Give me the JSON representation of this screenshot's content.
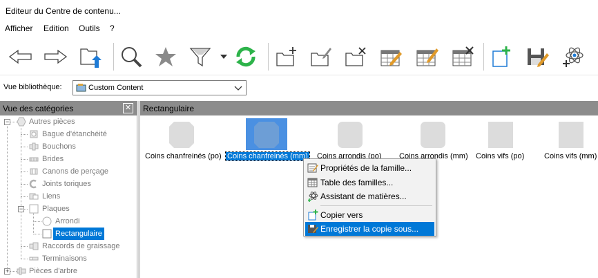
{
  "window": {
    "title": "Editeur du Centre de contenu..."
  },
  "menu": [
    "Afficher",
    "Edition",
    "Outils",
    "?"
  ],
  "toolbar": {
    "buttons": [
      "back-arrow-icon",
      "forward-arrow-icon",
      "folder-up-icon",
      "search-icon",
      "star-icon",
      "filter-icon",
      "dropdown-icon",
      "refresh-icon",
      "new-folder-icon",
      "edit-folder-icon",
      "delete-folder-icon",
      "table-edit-icon",
      "table-pencil-icon",
      "table-delete-icon",
      "add-page-icon",
      "save-edit-icon",
      "atom-add-icon"
    ]
  },
  "library": {
    "label": "Vue bibliothèque:",
    "value": "Custom Content"
  },
  "categories": {
    "title": "Vue des catégories",
    "close": "✕",
    "tree": [
      {
        "label": "Autres pièces",
        "level": 0,
        "expander": "−"
      },
      {
        "label": "Bague d'étanchéité",
        "level": 1
      },
      {
        "label": "Bouchons",
        "level": 1
      },
      {
        "label": "Brides",
        "level": 1
      },
      {
        "label": "Canons de perçage",
        "level": 1
      },
      {
        "label": "Joints toriques",
        "level": 1
      },
      {
        "label": "Liens",
        "level": 1
      },
      {
        "label": "Plaques",
        "level": 1,
        "expander": "−"
      },
      {
        "label": "Arrondi",
        "level": 2
      },
      {
        "label": "Rectangulaire",
        "level": 2,
        "selected": true
      },
      {
        "label": "Raccords de graissage",
        "level": 1
      },
      {
        "label": "Terminaisons",
        "level": 1
      },
      {
        "label": "Pièces d'arbre",
        "level": 0,
        "expander": "+"
      }
    ]
  },
  "content": {
    "title": "Rectangulaire",
    "items": [
      {
        "label": "Coins chanfreinés (po)",
        "shape": "chamfer"
      },
      {
        "label": "Coins chanfreinés (mm)",
        "shape": "chamfer",
        "selected": true
      },
      {
        "label": "Coins arrondis (po)",
        "shape": "rounded"
      },
      {
        "label": "Coins arrondis (mm)",
        "shape": "rounded"
      },
      {
        "label": "Coins vifs (po)",
        "shape": "sharp"
      },
      {
        "label": "Coins vifs (mm)",
        "shape": "sharp"
      }
    ]
  },
  "context_menu": {
    "items": [
      {
        "label": "Propriétés de la famille..."
      },
      {
        "label": "Table des familles..."
      },
      {
        "label": "Assistant de matières..."
      },
      {
        "label": "Copier vers"
      },
      {
        "label": "Enregistrer la copie sous...",
        "highlighted": true
      }
    ]
  },
  "colors": {
    "selection": "#0078d7",
    "header": "#8c8c8c",
    "thumb": "#dcdcdc",
    "accent_green": "#2db34a",
    "accent_blue": "#1e7bd6"
  }
}
